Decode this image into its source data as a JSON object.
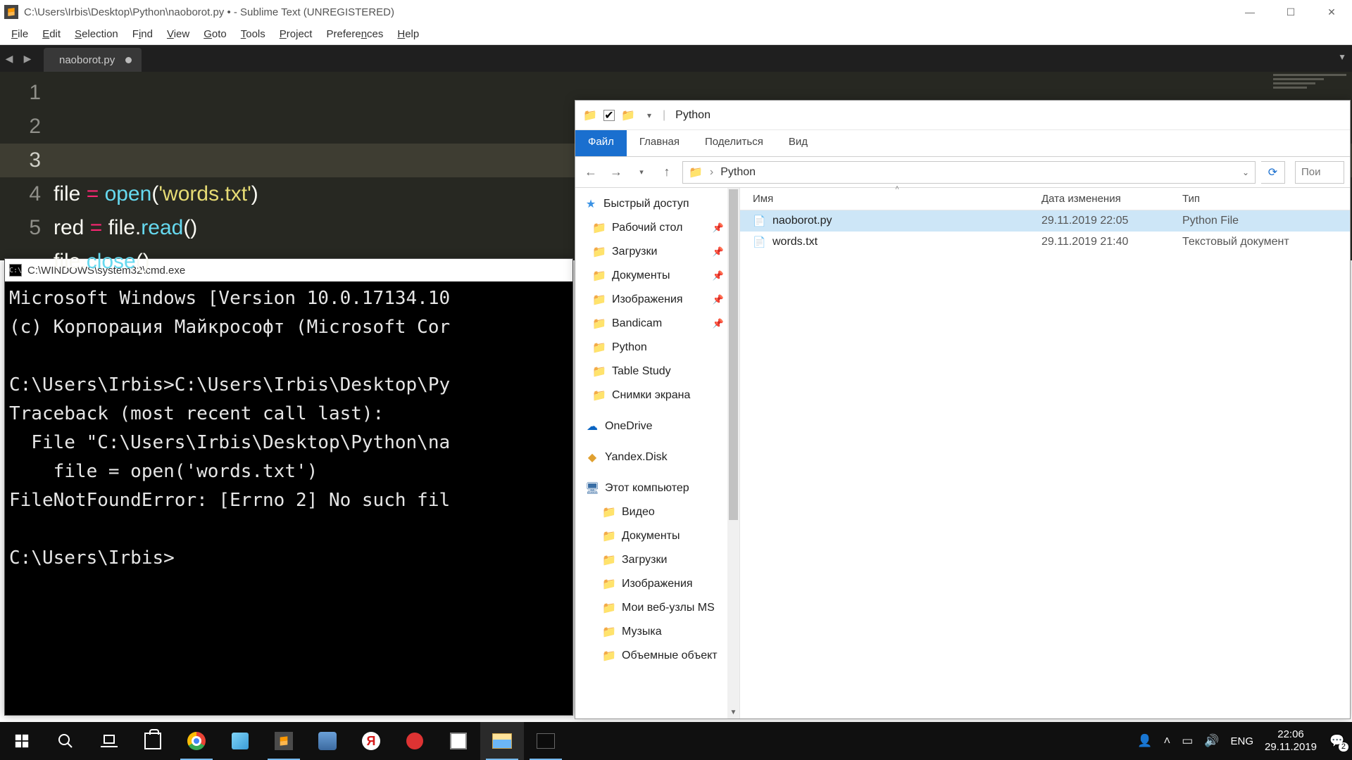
{
  "sublime": {
    "title": "C:\\Users\\Irbis\\Desktop\\Python\\naoborot.py • - Sublime Text (UNREGISTERED)",
    "menu": [
      "File",
      "Edit",
      "Selection",
      "Find",
      "View",
      "Goto",
      "Tools",
      "Project",
      "Preferences",
      "Help"
    ],
    "tab": {
      "label": "naoborot.py",
      "dirty": true
    },
    "code_lines": [
      "",
      "file = open('words.txt')",
      "red = file.read()",
      "file.close()",
      ""
    ],
    "active_line": 3
  },
  "cmd": {
    "title": "C:\\WINDOWS\\system32\\cmd.exe",
    "lines": [
      "Microsoft Windows [Version 10.0.17134.10",
      "(c) Корпорация Майкрософт (Microsoft Cor",
      "",
      "C:\\Users\\Irbis>C:\\Users\\Irbis\\Desktop\\Py",
      "Traceback (most recent call last):",
      "  File \"C:\\Users\\Irbis\\Desktop\\Python\\na",
      "    file = open('words.txt')",
      "FileNotFoundError: [Errno 2] No such fil",
      "",
      "C:\\Users\\Irbis>"
    ]
  },
  "explorer": {
    "title": "Python",
    "ribbon": {
      "file": "Файл",
      "tabs": [
        "Главная",
        "Поделиться",
        "Вид"
      ]
    },
    "breadcrumb": "Python",
    "refresh_icon": "refresh-icon",
    "search_placeholder": "Пои",
    "tree": {
      "quick_access": "Быстрый доступ",
      "quick_items": [
        {
          "label": "Рабочий стол",
          "pin": true
        },
        {
          "label": "Загрузки",
          "pin": true
        },
        {
          "label": "Документы",
          "pin": true
        },
        {
          "label": "Изображения",
          "pin": true
        },
        {
          "label": "Bandicam",
          "pin": true
        },
        {
          "label": "Python",
          "pin": false
        },
        {
          "label": "Table Study",
          "pin": false
        },
        {
          "label": "Снимки экрана",
          "pin": false
        }
      ],
      "onedrive": "OneDrive",
      "yandex": "Yandex.Disk",
      "thispc": "Этот компьютер",
      "pc_items": [
        "Видео",
        "Документы",
        "Загрузки",
        "Изображения",
        "Мои веб-узлы MS",
        "Музыка",
        "Объемные объект"
      ]
    },
    "columns": {
      "name": "Имя",
      "date": "Дата изменения",
      "type": "Тип"
    },
    "rows": [
      {
        "name": "naoborot.py",
        "date": "29.11.2019 22:05",
        "type": "Python File",
        "selected": true,
        "icon": "py"
      },
      {
        "name": "words.txt",
        "date": "29.11.2019 21:40",
        "type": "Текстовый документ",
        "selected": false,
        "icon": "txt"
      }
    ]
  },
  "taskbar": {
    "lang": "ENG",
    "time": "22:06",
    "date": "29.11.2019",
    "notif_count": "2"
  }
}
